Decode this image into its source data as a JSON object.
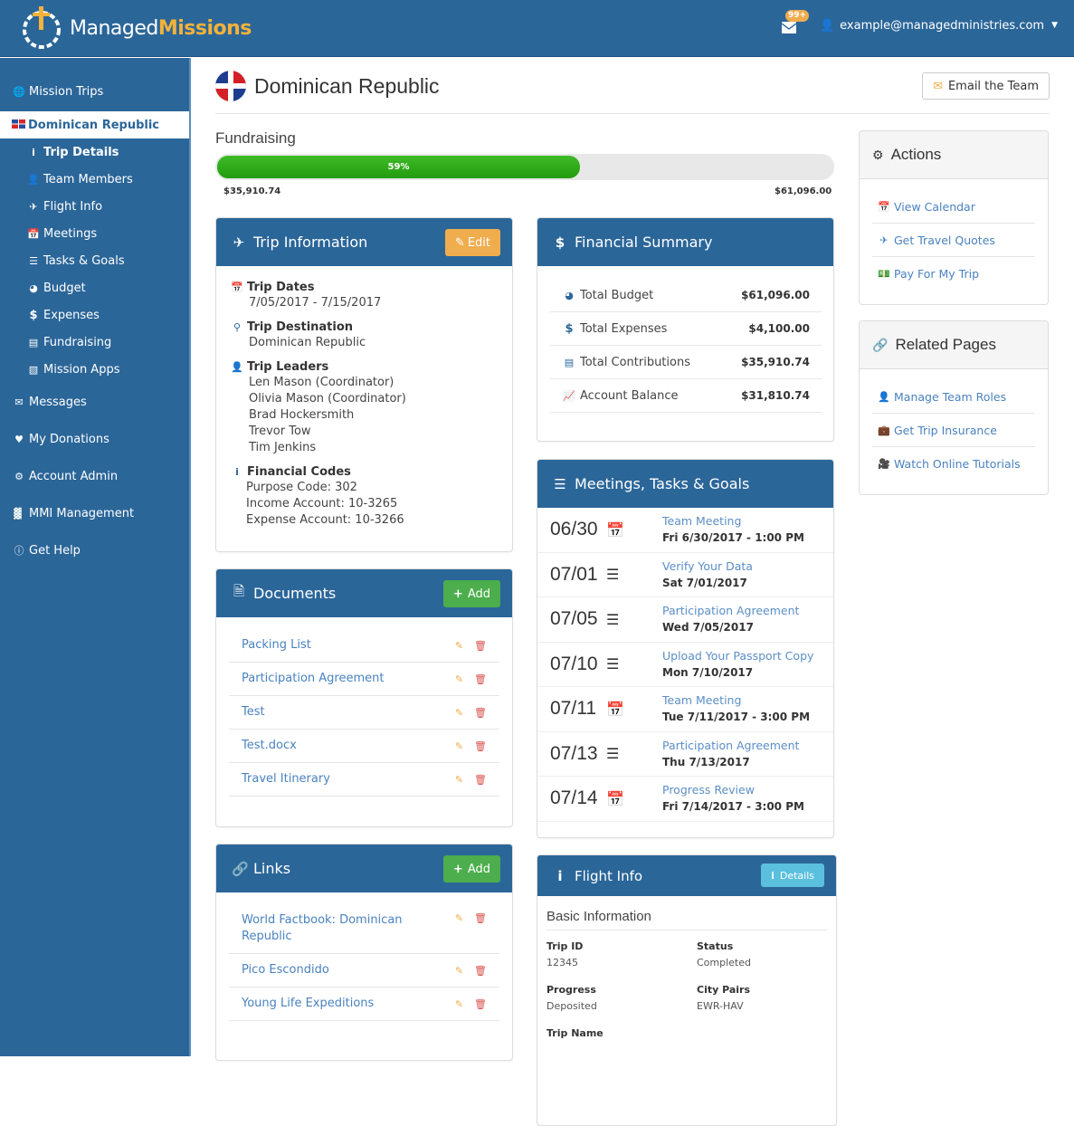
{
  "header": {
    "brand_part1": "Managed",
    "brand_part2": "Missions",
    "notification_badge": "99+",
    "user_email": "example@managedministries.com"
  },
  "sidebar": {
    "items": [
      {
        "label": "Mission Trips",
        "icon": "globe-icon"
      },
      {
        "label": "Dominican Republic",
        "icon": "flag-icon",
        "active": true
      },
      {
        "label": "Trip Details",
        "icon": "info-icon",
        "sub": true,
        "current": true
      },
      {
        "label": "Team Members",
        "icon": "user-icon",
        "sub": true
      },
      {
        "label": "Flight Info",
        "icon": "plane-icon",
        "sub": true
      },
      {
        "label": "Meetings",
        "icon": "calendar-icon",
        "sub": true
      },
      {
        "label": "Tasks & Goals",
        "icon": "list-icon",
        "sub": true
      },
      {
        "label": "Budget",
        "icon": "pie-chart-icon",
        "sub": true
      },
      {
        "label": "Expenses",
        "icon": "dollar-icon",
        "sub": true
      },
      {
        "label": "Fundraising",
        "icon": "credit-card-icon",
        "sub": true
      },
      {
        "label": "Mission Apps",
        "icon": "inbox-icon",
        "sub": true
      },
      {
        "label": "Messages",
        "icon": "envelope-open-icon"
      },
      {
        "label": "My Donations",
        "icon": "heart-icon"
      },
      {
        "label": "Account Admin",
        "icon": "gear-icon"
      },
      {
        "label": "MMI Management",
        "icon": "bar-chart-icon"
      },
      {
        "label": "Get Help",
        "icon": "info-circle-icon"
      }
    ]
  },
  "page": {
    "title": "Dominican Republic",
    "email_team_label": "Email the Team"
  },
  "fundraising": {
    "label": "Fundraising",
    "percent": 59,
    "percent_label": "59%",
    "raised": "$35,910.74",
    "goal": "$61,096.00"
  },
  "trip_info": {
    "title": "Trip Information",
    "edit_label": "Edit",
    "dates_label": "Trip Dates",
    "dates": "7/05/2017 - 7/15/2017",
    "destination_label": "Trip Destination",
    "destination": "Dominican Republic",
    "leaders_label": "Trip Leaders",
    "leaders": [
      "Len Mason (Coordinator)",
      "Olivia Mason (Coordinator)",
      "Brad Hockersmith",
      "Trevor Tow",
      "Tim Jenkins"
    ],
    "codes_label": "Financial Codes",
    "codes": [
      "Purpose Code: 302",
      "Income Account: 10-3265",
      "Expense Account: 10-3266"
    ]
  },
  "financial_summary": {
    "title": "Financial Summary",
    "rows": [
      {
        "label": "Total Budget",
        "value": "$61,096.00"
      },
      {
        "label": "Total Expenses",
        "value": "$4,100.00"
      },
      {
        "label": "Total Contributions",
        "value": "$35,910.74"
      },
      {
        "label": "Account Balance",
        "value": "$31,810.74"
      }
    ]
  },
  "meetings": {
    "title": "Meetings, Tasks & Goals",
    "items": [
      {
        "date": "06/30",
        "type": "meeting",
        "title": "Team Meeting",
        "when": "Fri 6/30/2017 - 1:00 PM"
      },
      {
        "date": "07/01",
        "type": "task",
        "title": "Verify Your Data",
        "when": "Sat 7/01/2017"
      },
      {
        "date": "07/05",
        "type": "task",
        "title": "Participation Agreement",
        "when": "Wed 7/05/2017"
      },
      {
        "date": "07/10",
        "type": "task",
        "title": "Upload Your Passport Copy",
        "when": "Mon 7/10/2017"
      },
      {
        "date": "07/11",
        "type": "meeting",
        "title": "Team Meeting",
        "when": "Tue 7/11/2017 - 3:00 PM"
      },
      {
        "date": "07/13",
        "type": "task",
        "title": "Participation Agreement",
        "when": "Thu 7/13/2017"
      },
      {
        "date": "07/14",
        "type": "meeting",
        "title": "Progress Review",
        "when": "Fri 7/14/2017 - 3:00 PM"
      }
    ]
  },
  "documents": {
    "title": "Documents",
    "add_label": "Add",
    "items": [
      "Packing List",
      "Participation Agreement",
      "Test",
      "Test.docx",
      "Travel Itinerary"
    ]
  },
  "links": {
    "title": "Links",
    "add_label": "Add",
    "items": [
      "World Factbook: Dominican Republic",
      "Pico Escondido",
      "Young Life Expeditions"
    ]
  },
  "flight_info": {
    "title": "Flight Info",
    "details_label": "Details",
    "section": "Basic Information",
    "fields": [
      {
        "label": "Trip ID",
        "value": "12345"
      },
      {
        "label": "Status",
        "value": "Completed"
      },
      {
        "label": "Progress",
        "value": "Deposited"
      },
      {
        "label": "City Pairs",
        "value": "EWR-HAV"
      },
      {
        "label": "Trip Name",
        "value": ""
      }
    ]
  },
  "actions": {
    "title": "Actions",
    "items": [
      {
        "label": "View Calendar",
        "icon": "calendar-icon"
      },
      {
        "label": "Get Travel Quotes",
        "icon": "plane-icon"
      },
      {
        "label": "Pay For My Trip",
        "icon": "money-icon"
      }
    ]
  },
  "related": {
    "title": "Related Pages",
    "items": [
      {
        "label": "Manage Team Roles",
        "icon": "user-icon"
      },
      {
        "label": "Get Trip Insurance",
        "icon": "briefcase-icon"
      },
      {
        "label": "Watch Online Tutorials",
        "icon": "video-camera-icon"
      }
    ]
  }
}
